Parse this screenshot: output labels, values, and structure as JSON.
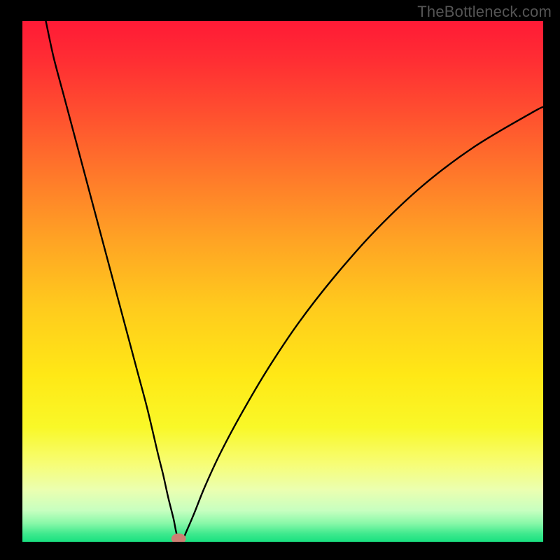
{
  "watermark": "TheBottleneck.com",
  "chart_data": {
    "type": "line",
    "title": "",
    "xlabel": "",
    "ylabel": "",
    "xlim": [
      0,
      100
    ],
    "ylim": [
      0,
      100
    ],
    "background_gradient_stops": [
      {
        "offset": 0.0,
        "color": "#ff1a36"
      },
      {
        "offset": 0.08,
        "color": "#ff2f33"
      },
      {
        "offset": 0.18,
        "color": "#ff502f"
      },
      {
        "offset": 0.3,
        "color": "#ff7a2a"
      },
      {
        "offset": 0.42,
        "color": "#ffa324"
      },
      {
        "offset": 0.55,
        "color": "#ffcb1d"
      },
      {
        "offset": 0.68,
        "color": "#ffe816"
      },
      {
        "offset": 0.78,
        "color": "#f9f828"
      },
      {
        "offset": 0.85,
        "color": "#f7fd75"
      },
      {
        "offset": 0.9,
        "color": "#ebffb0"
      },
      {
        "offset": 0.94,
        "color": "#c7ffc0"
      },
      {
        "offset": 0.965,
        "color": "#87f8a8"
      },
      {
        "offset": 0.985,
        "color": "#3de98d"
      },
      {
        "offset": 1.0,
        "color": "#19e080"
      }
    ],
    "series": [
      {
        "name": "bottleneck-curve",
        "color": "#000000",
        "x": [
          4.5,
          6,
          8,
          10,
          12,
          14,
          16,
          18,
          20,
          22,
          24,
          26,
          27,
          28,
          29,
          29.5,
          30,
          30.7,
          31.5,
          33,
          35,
          38,
          42,
          47,
          53,
          60,
          68,
          77,
          87,
          98,
          100
        ],
        "y": [
          100,
          93,
          85.5,
          78,
          70.5,
          63,
          55.5,
          48,
          40.5,
          33,
          25.5,
          17,
          13,
          8.5,
          4.5,
          2,
          0.3,
          0.3,
          2,
          5.5,
          10.5,
          17,
          24.5,
          33,
          42,
          51,
          60,
          68.5,
          76,
          82.5,
          83.5
        ]
      }
    ],
    "marker": {
      "name": "vertex-marker",
      "x": 30,
      "y": 0.6,
      "rx": 1.4,
      "ry": 1.0,
      "color": "#cd8073"
    }
  }
}
